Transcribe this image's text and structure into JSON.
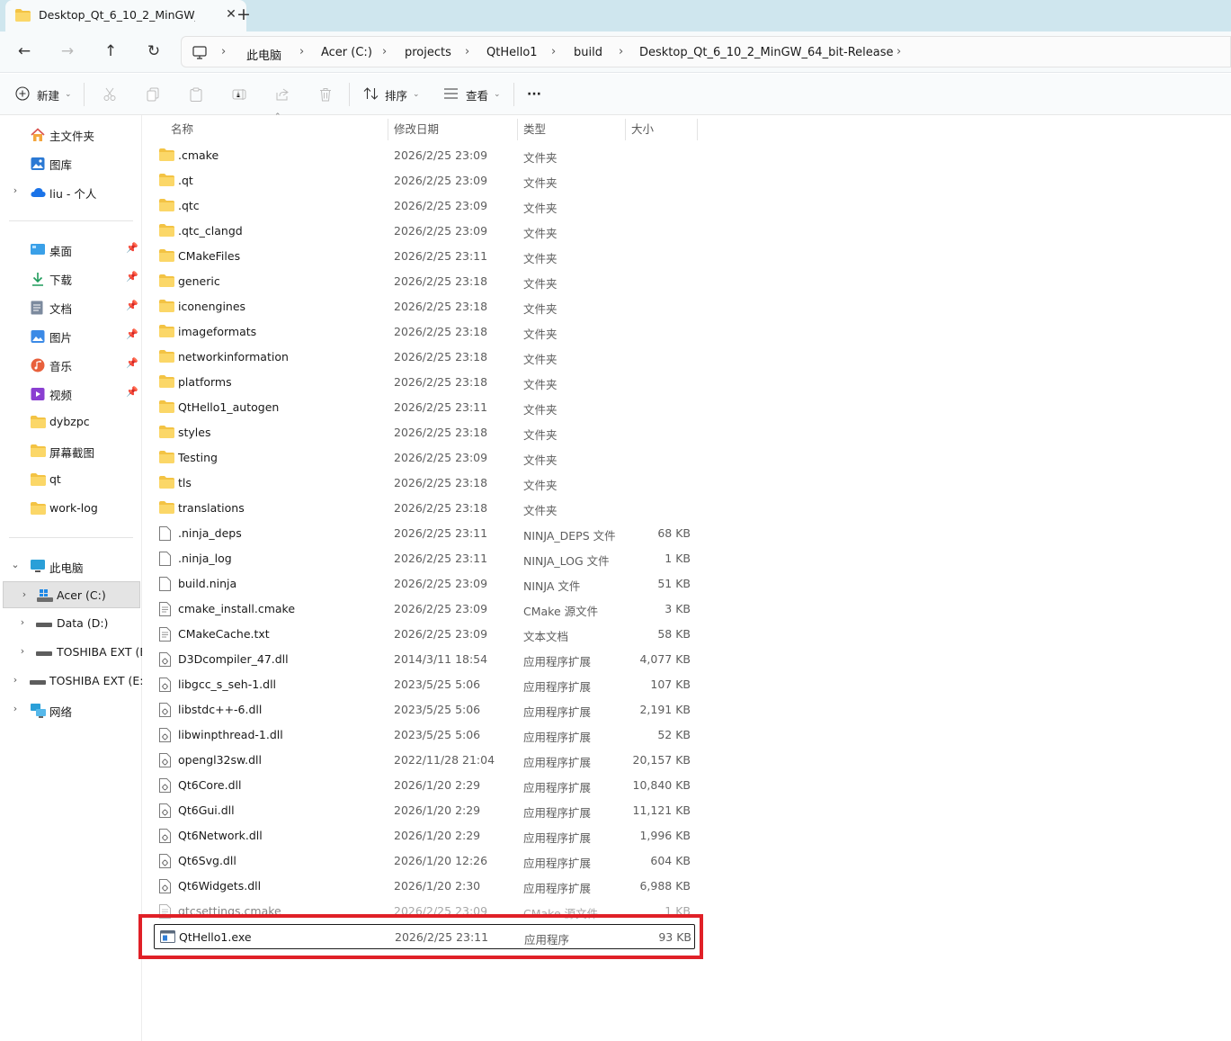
{
  "tab": {
    "title": "Desktop_Qt_6_10_2_MinGW_64_bit-Release",
    "close": "✕",
    "new": "+"
  },
  "nav": {
    "back": "←",
    "forward": "→",
    "up": "↑",
    "refresh": "↻"
  },
  "breadcrumb": [
    "此电脑",
    "Acer (C:)",
    "projects",
    "QtHello1",
    "build",
    "Desktop_Qt_6_10_2_MinGW_64_bit-Release"
  ],
  "toolbar": {
    "new_label": "新建",
    "sort_label": "排序",
    "view_label": "查看",
    "more": "···"
  },
  "sidebar": {
    "quick": [
      {
        "label": "主文件夹",
        "icon": "home-icon"
      },
      {
        "label": "图库",
        "icon": "gallery-icon"
      },
      {
        "label": "liu - 个人",
        "icon": "cloud-icon"
      }
    ],
    "pinned": [
      {
        "label": "桌面",
        "icon": "desktop-icon"
      },
      {
        "label": "下载",
        "icon": "download-icon"
      },
      {
        "label": "文档",
        "icon": "documents-icon"
      },
      {
        "label": "图片",
        "icon": "pictures-icon"
      },
      {
        "label": "音乐",
        "icon": "music-icon"
      },
      {
        "label": "视频",
        "icon": "videos-icon"
      },
      {
        "label": "dybzpc",
        "icon": "folder-icon"
      },
      {
        "label": "屏幕截图",
        "icon": "folder-icon"
      },
      {
        "label": "qt",
        "icon": "folder-icon"
      },
      {
        "label": "work-log",
        "icon": "folder-icon"
      }
    ],
    "this_pc": "此电脑",
    "drives": [
      "Acer (C:)",
      "Data (D:)",
      "TOSHIBA EXT (E:)"
    ],
    "ext_drive": "TOSHIBA EXT (E:)",
    "network": "网络"
  },
  "columns": {
    "name": "名称",
    "date": "修改日期",
    "type": "类型",
    "size": "大小"
  },
  "files": [
    {
      "name": ".cmake",
      "date": "2026/2/25 23:09",
      "type": "文件夹",
      "size": "",
      "icon": "folder"
    },
    {
      "name": ".qt",
      "date": "2026/2/25 23:09",
      "type": "文件夹",
      "size": "",
      "icon": "folder"
    },
    {
      "name": ".qtc",
      "date": "2026/2/25 23:09",
      "type": "文件夹",
      "size": "",
      "icon": "folder"
    },
    {
      "name": ".qtc_clangd",
      "date": "2026/2/25 23:09",
      "type": "文件夹",
      "size": "",
      "icon": "folder"
    },
    {
      "name": "CMakeFiles",
      "date": "2026/2/25 23:11",
      "type": "文件夹",
      "size": "",
      "icon": "folder"
    },
    {
      "name": "generic",
      "date": "2026/2/25 23:18",
      "type": "文件夹",
      "size": "",
      "icon": "folder"
    },
    {
      "name": "iconengines",
      "date": "2026/2/25 23:18",
      "type": "文件夹",
      "size": "",
      "icon": "folder"
    },
    {
      "name": "imageformats",
      "date": "2026/2/25 23:18",
      "type": "文件夹",
      "size": "",
      "icon": "folder"
    },
    {
      "name": "networkinformation",
      "date": "2026/2/25 23:18",
      "type": "文件夹",
      "size": "",
      "icon": "folder"
    },
    {
      "name": "platforms",
      "date": "2026/2/25 23:18",
      "type": "文件夹",
      "size": "",
      "icon": "folder"
    },
    {
      "name": "QtHello1_autogen",
      "date": "2026/2/25 23:11",
      "type": "文件夹",
      "size": "",
      "icon": "folder"
    },
    {
      "name": "styles",
      "date": "2026/2/25 23:18",
      "type": "文件夹",
      "size": "",
      "icon": "folder"
    },
    {
      "name": "Testing",
      "date": "2026/2/25 23:09",
      "type": "文件夹",
      "size": "",
      "icon": "folder"
    },
    {
      "name": "tls",
      "date": "2026/2/25 23:18",
      "type": "文件夹",
      "size": "",
      "icon": "folder"
    },
    {
      "name": "translations",
      "date": "2026/2/25 23:18",
      "type": "文件夹",
      "size": "",
      "icon": "folder"
    },
    {
      "name": ".ninja_deps",
      "date": "2026/2/25 23:11",
      "type": "NINJA_DEPS 文件",
      "size": "68 KB",
      "icon": "file"
    },
    {
      "name": ".ninja_log",
      "date": "2026/2/25 23:11",
      "type": "NINJA_LOG 文件",
      "size": "1 KB",
      "icon": "file"
    },
    {
      "name": "build.ninja",
      "date": "2026/2/25 23:09",
      "type": "NINJA 文件",
      "size": "51 KB",
      "icon": "file"
    },
    {
      "name": "cmake_install.cmake",
      "date": "2026/2/25 23:09",
      "type": "CMake 源文件",
      "size": "3 KB",
      "icon": "text"
    },
    {
      "name": "CMakeCache.txt",
      "date": "2026/2/25 23:09",
      "type": "文本文档",
      "size": "58 KB",
      "icon": "text"
    },
    {
      "name": "D3Dcompiler_47.dll",
      "date": "2014/3/11 18:54",
      "type": "应用程序扩展",
      "size": "4,077 KB",
      "icon": "dll"
    },
    {
      "name": "libgcc_s_seh-1.dll",
      "date": "2023/5/25 5:06",
      "type": "应用程序扩展",
      "size": "107 KB",
      "icon": "dll"
    },
    {
      "name": "libstdc++-6.dll",
      "date": "2023/5/25 5:06",
      "type": "应用程序扩展",
      "size": "2,191 KB",
      "icon": "dll"
    },
    {
      "name": "libwinpthread-1.dll",
      "date": "2023/5/25 5:06",
      "type": "应用程序扩展",
      "size": "52 KB",
      "icon": "dll"
    },
    {
      "name": "opengl32sw.dll",
      "date": "2022/11/28 21:04",
      "type": "应用程序扩展",
      "size": "20,157 KB",
      "icon": "dll"
    },
    {
      "name": "Qt6Core.dll",
      "date": "2026/1/20 2:29",
      "type": "应用程序扩展",
      "size": "10,840 KB",
      "icon": "dll"
    },
    {
      "name": "Qt6Gui.dll",
      "date": "2026/1/20 2:29",
      "type": "应用程序扩展",
      "size": "11,121 KB",
      "icon": "dll"
    },
    {
      "name": "Qt6Network.dll",
      "date": "2026/1/20 2:29",
      "type": "应用程序扩展",
      "size": "1,996 KB",
      "icon": "dll"
    },
    {
      "name": "Qt6Svg.dll",
      "date": "2026/1/20 12:26",
      "type": "应用程序扩展",
      "size": "604 KB",
      "icon": "dll"
    },
    {
      "name": "Qt6Widgets.dll",
      "date": "2026/1/20 2:30",
      "type": "应用程序扩展",
      "size": "6,988 KB",
      "icon": "dll"
    },
    {
      "name": "qtcsettings.cmake",
      "date": "2026/2/25 23:09",
      "type": "CMake 源文件",
      "size": "1 KB",
      "icon": "text"
    },
    {
      "name": "QtHello1.exe",
      "date": "2026/2/25 23:11",
      "type": "应用程序",
      "size": "93 KB",
      "icon": "exe",
      "selected": true
    }
  ],
  "colors": {
    "accent": "#e02027",
    "folder": "#f3c344",
    "tabbar": "#cfe6ee"
  }
}
